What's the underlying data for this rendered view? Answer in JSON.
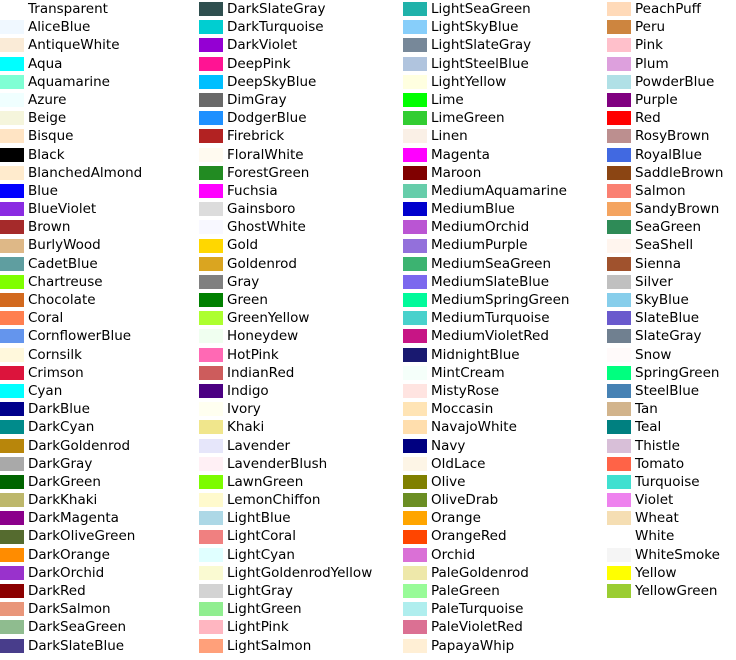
{
  "page": {
    "title": "Color Names",
    "background": "#ffffff",
    "text_color": "#000000",
    "columns": 4,
    "rows_per_column": 36
  },
  "columns": [
    {
      "name": "column-1",
      "swatches": [
        {
          "label": "Transparent",
          "hex": "transparent"
        },
        {
          "label": "AliceBlue",
          "hex": "#F0F8FF"
        },
        {
          "label": "AntiqueWhite",
          "hex": "#FAEBD7"
        },
        {
          "label": "Aqua",
          "hex": "#00FFFF"
        },
        {
          "label": "Aquamarine",
          "hex": "#7FFFD4"
        },
        {
          "label": "Azure",
          "hex": "#F0FFFF"
        },
        {
          "label": "Beige",
          "hex": "#F5F5DC"
        },
        {
          "label": "Bisque",
          "hex": "#FFE4C4"
        },
        {
          "label": "Black",
          "hex": "#000000"
        },
        {
          "label": "BlanchedAlmond",
          "hex": "#FFEBCD"
        },
        {
          "label": "Blue",
          "hex": "#0000FF"
        },
        {
          "label": "BlueViolet",
          "hex": "#8A2BE2"
        },
        {
          "label": "Brown",
          "hex": "#A52A2A"
        },
        {
          "label": "BurlyWood",
          "hex": "#DEB887"
        },
        {
          "label": "CadetBlue",
          "hex": "#5F9EA0"
        },
        {
          "label": "Chartreuse",
          "hex": "#7FFF00"
        },
        {
          "label": "Chocolate",
          "hex": "#D2691E"
        },
        {
          "label": "Coral",
          "hex": "#FF7F50"
        },
        {
          "label": "CornflowerBlue",
          "hex": "#6495ED"
        },
        {
          "label": "Cornsilk",
          "hex": "#FFF8DC"
        },
        {
          "label": "Crimson",
          "hex": "#DC143C"
        },
        {
          "label": "Cyan",
          "hex": "#00FFFF"
        },
        {
          "label": "DarkBlue",
          "hex": "#00008B"
        },
        {
          "label": "DarkCyan",
          "hex": "#008B8B"
        },
        {
          "label": "DarkGoldenrod",
          "hex": "#B8860B"
        },
        {
          "label": "DarkGray",
          "hex": "#A9A9A9"
        },
        {
          "label": "DarkGreen",
          "hex": "#006400"
        },
        {
          "label": "DarkKhaki",
          "hex": "#BDB76B"
        },
        {
          "label": "DarkMagenta",
          "hex": "#8B008B"
        },
        {
          "label": "DarkOliveGreen",
          "hex": "#556B2F"
        },
        {
          "label": "DarkOrange",
          "hex": "#FF8C00"
        },
        {
          "label": "DarkOrchid",
          "hex": "#9932CC"
        },
        {
          "label": "DarkRed",
          "hex": "#8B0000"
        },
        {
          "label": "DarkSalmon",
          "hex": "#E9967A"
        },
        {
          "label": "DarkSeaGreen",
          "hex": "#8FBC8F"
        },
        {
          "label": "DarkSlateBlue",
          "hex": "#483D8B"
        }
      ]
    },
    {
      "name": "column-2",
      "swatches": [
        {
          "label": "DarkSlateGray",
          "hex": "#2F4F4F"
        },
        {
          "label": "DarkTurquoise",
          "hex": "#00CED1"
        },
        {
          "label": "DarkViolet",
          "hex": "#9400D3"
        },
        {
          "label": "DeepPink",
          "hex": "#FF1493"
        },
        {
          "label": "DeepSkyBlue",
          "hex": "#00BFFF"
        },
        {
          "label": "DimGray",
          "hex": "#696969"
        },
        {
          "label": "DodgerBlue",
          "hex": "#1E90FF"
        },
        {
          "label": "Firebrick",
          "hex": "#B22222"
        },
        {
          "label": "FloralWhite",
          "hex": "#FFFAF0"
        },
        {
          "label": "ForestGreen",
          "hex": "#228B22"
        },
        {
          "label": "Fuchsia",
          "hex": "#FF00FF"
        },
        {
          "label": "Gainsboro",
          "hex": "#DCDCDC"
        },
        {
          "label": "GhostWhite",
          "hex": "#F8F8FF"
        },
        {
          "label": "Gold",
          "hex": "#FFD700"
        },
        {
          "label": "Goldenrod",
          "hex": "#DAA520"
        },
        {
          "label": "Gray",
          "hex": "#808080"
        },
        {
          "label": "Green",
          "hex": "#008000"
        },
        {
          "label": "GreenYellow",
          "hex": "#ADFF2F"
        },
        {
          "label": "Honeydew",
          "hex": "#F0FFF0"
        },
        {
          "label": "HotPink",
          "hex": "#FF69B4"
        },
        {
          "label": "IndianRed",
          "hex": "#CD5C5C"
        },
        {
          "label": "Indigo",
          "hex": "#4B0082"
        },
        {
          "label": "Ivory",
          "hex": "#FFFFF0"
        },
        {
          "label": "Khaki",
          "hex": "#F0E68C"
        },
        {
          "label": "Lavender",
          "hex": "#E6E6FA"
        },
        {
          "label": "LavenderBlush",
          "hex": "#FFF0F5"
        },
        {
          "label": "LawnGreen",
          "hex": "#7CFC00"
        },
        {
          "label": "LemonChiffon",
          "hex": "#FFFACD"
        },
        {
          "label": "LightBlue",
          "hex": "#ADD8E6"
        },
        {
          "label": "LightCoral",
          "hex": "#F08080"
        },
        {
          "label": "LightCyan",
          "hex": "#E0FFFF"
        },
        {
          "label": "LightGoldenrodYellow",
          "hex": "#FAFAD2"
        },
        {
          "label": "LightGray",
          "hex": "#D3D3D3"
        },
        {
          "label": "LightGreen",
          "hex": "#90EE90"
        },
        {
          "label": "LightPink",
          "hex": "#FFB6C1"
        },
        {
          "label": "LightSalmon",
          "hex": "#FFA07A"
        }
      ]
    },
    {
      "name": "column-3",
      "swatches": [
        {
          "label": "LightSeaGreen",
          "hex": "#20B2AA"
        },
        {
          "label": "LightSkyBlue",
          "hex": "#87CEFA"
        },
        {
          "label": "LightSlateGray",
          "hex": "#778899"
        },
        {
          "label": "LightSteelBlue",
          "hex": "#B0C4DE"
        },
        {
          "label": "LightYellow",
          "hex": "#FFFFE0"
        },
        {
          "label": "Lime",
          "hex": "#00FF00"
        },
        {
          "label": "LimeGreen",
          "hex": "#32CD32"
        },
        {
          "label": "Linen",
          "hex": "#FAF0E6"
        },
        {
          "label": "Magenta",
          "hex": "#FF00FF"
        },
        {
          "label": "Maroon",
          "hex": "#800000"
        },
        {
          "label": "MediumAquamarine",
          "hex": "#66CDAA"
        },
        {
          "label": "MediumBlue",
          "hex": "#0000CD"
        },
        {
          "label": "MediumOrchid",
          "hex": "#BA55D3"
        },
        {
          "label": "MediumPurple",
          "hex": "#9370DB"
        },
        {
          "label": "MediumSeaGreen",
          "hex": "#3CB371"
        },
        {
          "label": "MediumSlateBlue",
          "hex": "#7B68EE"
        },
        {
          "label": "MediumSpringGreen",
          "hex": "#00FA9A"
        },
        {
          "label": "MediumTurquoise",
          "hex": "#48D1CC"
        },
        {
          "label": "MediumVioletRed",
          "hex": "#C71585"
        },
        {
          "label": "MidnightBlue",
          "hex": "#191970"
        },
        {
          "label": "MintCream",
          "hex": "#F5FFFA"
        },
        {
          "label": "MistyRose",
          "hex": "#FFE4E1"
        },
        {
          "label": "Moccasin",
          "hex": "#FFE4B5"
        },
        {
          "label": "NavajoWhite",
          "hex": "#FFDEAD"
        },
        {
          "label": "Navy",
          "hex": "#000080"
        },
        {
          "label": "OldLace",
          "hex": "#FDF5E6"
        },
        {
          "label": "Olive",
          "hex": "#808000"
        },
        {
          "label": "OliveDrab",
          "hex": "#6B8E23"
        },
        {
          "label": "Orange",
          "hex": "#FFA500"
        },
        {
          "label": "OrangeRed",
          "hex": "#FF4500"
        },
        {
          "label": "Orchid",
          "hex": "#DA70D6"
        },
        {
          "label": "PaleGoldenrod",
          "hex": "#EEE8AA"
        },
        {
          "label": "PaleGreen",
          "hex": "#98FB98"
        },
        {
          "label": "PaleTurquoise",
          "hex": "#AFEEEE"
        },
        {
          "label": "PaleVioletRed",
          "hex": "#DB7093"
        },
        {
          "label": "PapayaWhip",
          "hex": "#FFEFD5"
        }
      ]
    },
    {
      "name": "column-4",
      "swatches": [
        {
          "label": "PeachPuff",
          "hex": "#FFDAB9"
        },
        {
          "label": "Peru",
          "hex": "#CD853F"
        },
        {
          "label": "Pink",
          "hex": "#FFC0CB"
        },
        {
          "label": "Plum",
          "hex": "#DDA0DD"
        },
        {
          "label": "PowderBlue",
          "hex": "#B0E0E6"
        },
        {
          "label": "Purple",
          "hex": "#800080"
        },
        {
          "label": "Red",
          "hex": "#FF0000"
        },
        {
          "label": "RosyBrown",
          "hex": "#BC8F8F"
        },
        {
          "label": "RoyalBlue",
          "hex": "#4169E1"
        },
        {
          "label": "SaddleBrown",
          "hex": "#8B4513"
        },
        {
          "label": "Salmon",
          "hex": "#FA8072"
        },
        {
          "label": "SandyBrown",
          "hex": "#F4A460"
        },
        {
          "label": "SeaGreen",
          "hex": "#2E8B57"
        },
        {
          "label": "SeaShell",
          "hex": "#FFF5EE"
        },
        {
          "label": "Sienna",
          "hex": "#A0522D"
        },
        {
          "label": "Silver",
          "hex": "#C0C0C0"
        },
        {
          "label": "SkyBlue",
          "hex": "#87CEEB"
        },
        {
          "label": "SlateBlue",
          "hex": "#6A5ACD"
        },
        {
          "label": "SlateGray",
          "hex": "#708090"
        },
        {
          "label": "Snow",
          "hex": "#FFFAFA"
        },
        {
          "label": "SpringGreen",
          "hex": "#00FF7F"
        },
        {
          "label": "SteelBlue",
          "hex": "#4682B4"
        },
        {
          "label": "Tan",
          "hex": "#D2B48C"
        },
        {
          "label": "Teal",
          "hex": "#008080"
        },
        {
          "label": "Thistle",
          "hex": "#D8BFD8"
        },
        {
          "label": "Tomato",
          "hex": "#FF6347"
        },
        {
          "label": "Turquoise",
          "hex": "#40E0D0"
        },
        {
          "label": "Violet",
          "hex": "#EE82EE"
        },
        {
          "label": "Wheat",
          "hex": "#F5DEB3"
        },
        {
          "label": "White",
          "hex": "#FFFFFF"
        },
        {
          "label": "WhiteSmoke",
          "hex": "#F5F5F5"
        },
        {
          "label": "Yellow",
          "hex": "#FFFF00"
        },
        {
          "label": "YellowGreen",
          "hex": "#9ACD32"
        }
      ]
    }
  ]
}
